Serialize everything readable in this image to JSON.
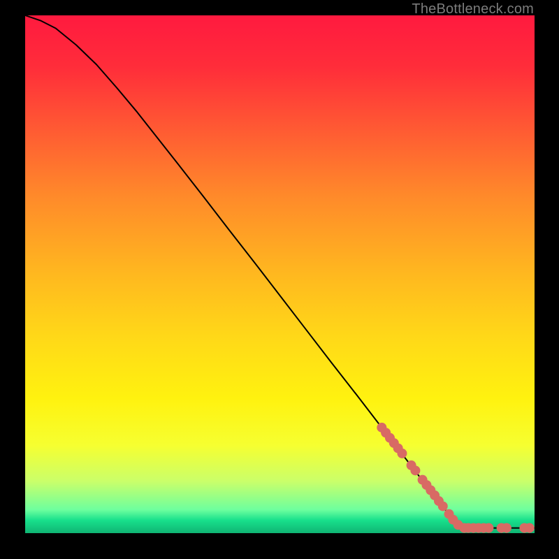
{
  "watermark": "TheBottleneck.com",
  "chart_data": {
    "type": "line",
    "title": "",
    "xlabel": "",
    "ylabel": "",
    "xlim": [
      0,
      100
    ],
    "ylim": [
      0,
      100
    ],
    "gradient_stops": [
      {
        "offset": 0.0,
        "color": "#ff1a3f"
      },
      {
        "offset": 0.1,
        "color": "#ff2d3a"
      },
      {
        "offset": 0.22,
        "color": "#ff5a33"
      },
      {
        "offset": 0.35,
        "color": "#ff8a2a"
      },
      {
        "offset": 0.5,
        "color": "#ffb81f"
      },
      {
        "offset": 0.62,
        "color": "#ffd818"
      },
      {
        "offset": 0.74,
        "color": "#fff20f"
      },
      {
        "offset": 0.83,
        "color": "#f6ff30"
      },
      {
        "offset": 0.9,
        "color": "#caff6a"
      },
      {
        "offset": 0.955,
        "color": "#6dff9e"
      },
      {
        "offset": 0.975,
        "color": "#18e08c"
      },
      {
        "offset": 1.0,
        "color": "#0fb573"
      }
    ],
    "curve": [
      {
        "x": 0.0,
        "y": 100.0
      },
      {
        "x": 3.0,
        "y": 99.0
      },
      {
        "x": 6.0,
        "y": 97.5
      },
      {
        "x": 10.0,
        "y": 94.3
      },
      {
        "x": 14.0,
        "y": 90.5
      },
      {
        "x": 18.0,
        "y": 86.0
      },
      {
        "x": 22.0,
        "y": 81.3
      },
      {
        "x": 26.0,
        "y": 76.3
      },
      {
        "x": 30.0,
        "y": 71.3
      },
      {
        "x": 35.0,
        "y": 65.0
      },
      {
        "x": 40.0,
        "y": 58.6
      },
      {
        "x": 45.0,
        "y": 52.3
      },
      {
        "x": 50.0,
        "y": 45.9
      },
      {
        "x": 55.0,
        "y": 39.5
      },
      {
        "x": 60.0,
        "y": 33.1
      },
      {
        "x": 65.0,
        "y": 26.8
      },
      {
        "x": 70.0,
        "y": 20.4
      },
      {
        "x": 75.0,
        "y": 14.0
      },
      {
        "x": 80.0,
        "y": 7.6
      },
      {
        "x": 84.0,
        "y": 2.6
      },
      {
        "x": 85.6,
        "y": 1.2
      },
      {
        "x": 86.2,
        "y": 1.0
      },
      {
        "x": 90.0,
        "y": 1.0
      },
      {
        "x": 95.0,
        "y": 1.0
      },
      {
        "x": 100.0,
        "y": 1.0
      }
    ],
    "markers": [
      {
        "x": 70.0,
        "y": 20.4
      },
      {
        "x": 70.8,
        "y": 19.4
      },
      {
        "x": 71.6,
        "y": 18.4
      },
      {
        "x": 72.4,
        "y": 17.4
      },
      {
        "x": 73.2,
        "y": 16.4
      },
      {
        "x": 74.0,
        "y": 15.4
      },
      {
        "x": 75.8,
        "y": 13.1
      },
      {
        "x": 76.6,
        "y": 12.1
      },
      {
        "x": 78.0,
        "y": 10.3
      },
      {
        "x": 78.8,
        "y": 9.3
      },
      {
        "x": 79.6,
        "y": 8.3
      },
      {
        "x": 80.4,
        "y": 7.3
      },
      {
        "x": 81.2,
        "y": 6.2
      },
      {
        "x": 82.0,
        "y": 5.2
      },
      {
        "x": 83.2,
        "y": 3.7
      },
      {
        "x": 84.0,
        "y": 2.6
      },
      {
        "x": 85.0,
        "y": 1.6
      },
      {
        "x": 86.2,
        "y": 1.0
      },
      {
        "x": 87.0,
        "y": 1.0
      },
      {
        "x": 88.0,
        "y": 1.0
      },
      {
        "x": 89.0,
        "y": 1.0
      },
      {
        "x": 90.0,
        "y": 1.0
      },
      {
        "x": 91.0,
        "y": 1.0
      },
      {
        "x": 93.5,
        "y": 1.0
      },
      {
        "x": 94.5,
        "y": 1.0
      },
      {
        "x": 98.0,
        "y": 1.0
      },
      {
        "x": 99.0,
        "y": 1.0
      }
    ],
    "marker_color": "#d86a64",
    "curve_color": "#000000"
  }
}
